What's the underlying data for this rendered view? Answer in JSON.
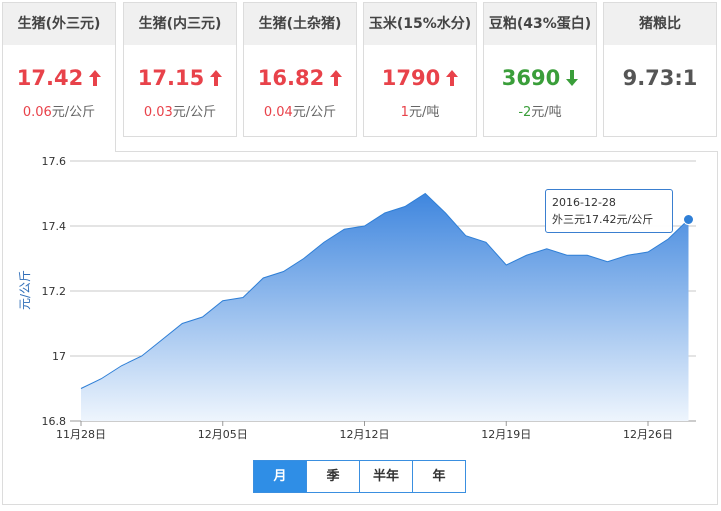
{
  "cards": [
    {
      "title": "生猪(外三元)",
      "price": "17.42",
      "direction": "up",
      "change_value": "0.06",
      "unit": "元/公斤",
      "active": true
    },
    {
      "title": "生猪(内三元)",
      "price": "17.15",
      "direction": "up",
      "change_value": "0.03",
      "unit": "元/公斤",
      "active": false
    },
    {
      "title": "生猪(土杂猪)",
      "price": "16.82",
      "direction": "up",
      "change_value": "0.04",
      "unit": "元/公斤",
      "active": false
    },
    {
      "title": "玉米(15%水分)",
      "price": "1790",
      "direction": "up",
      "change_value": "1",
      "unit": "元/吨",
      "active": false
    },
    {
      "title": "豆粕(43%蛋白)",
      "price": "3690",
      "direction": "down",
      "change_value": "-2",
      "unit": "元/吨",
      "active": false
    },
    {
      "title": "猪粮比",
      "price": "9.73:1",
      "direction": "none",
      "change_value": "",
      "unit": "",
      "active": false
    }
  ],
  "range_buttons": [
    {
      "label": "月",
      "active": true
    },
    {
      "label": "季",
      "active": false
    },
    {
      "label": "半年",
      "active": false
    },
    {
      "label": "年",
      "active": false
    }
  ],
  "tooltip": {
    "date": "2016-12-28",
    "text": "外三元17.42元/公斤"
  },
  "colors": {
    "up": "#e8424a",
    "down": "#3a9e3a",
    "accent": "#2f8ee6",
    "area_top": "#3f86de",
    "area_bottom": "#eef5fd"
  },
  "chart_data": {
    "type": "area",
    "ylabel": "元/公斤",
    "xlabel": "",
    "ylim": [
      16.8,
      17.6
    ],
    "yticks": [
      16.8,
      17,
      17.2,
      17.4,
      17.6
    ],
    "ytick_labels": [
      "16.8",
      "17",
      "17.2",
      "17.4",
      "17.6"
    ],
    "grid": true,
    "xticks": [
      {
        "date": "2016-11-28",
        "label": "11月28日"
      },
      {
        "date": "2016-12-05",
        "label": "12月05日"
      },
      {
        "date": "2016-12-12",
        "label": "12月12日"
      },
      {
        "date": "2016-12-19",
        "label": "12月19日"
      },
      {
        "date": "2016-12-26",
        "label": "12月26日"
      }
    ],
    "series": [
      {
        "x": [
          "2016-11-28",
          "2016-11-29",
          "2016-11-30",
          "2016-12-01",
          "2016-12-02",
          "2016-12-03",
          "2016-12-04",
          "2016-12-05",
          "2016-12-06",
          "2016-12-07",
          "2016-12-08",
          "2016-12-09",
          "2016-12-10",
          "2016-12-11",
          "2016-12-12",
          "2016-12-13",
          "2016-12-14",
          "2016-12-15",
          "2016-12-16",
          "2016-12-17",
          "2016-12-18",
          "2016-12-19",
          "2016-12-20",
          "2016-12-21",
          "2016-12-22",
          "2016-12-23",
          "2016-12-24",
          "2016-12-25",
          "2016-12-26",
          "2016-12-27",
          "2016-12-28"
        ],
        "values": [
          16.9,
          16.93,
          16.97,
          17.0,
          17.05,
          17.1,
          17.12,
          17.17,
          17.18,
          17.24,
          17.26,
          17.3,
          17.35,
          17.39,
          17.4,
          17.44,
          17.46,
          17.5,
          17.44,
          17.37,
          17.35,
          17.28,
          17.31,
          17.33,
          17.31,
          17.31,
          17.29,
          17.31,
          17.32,
          17.36,
          17.42
        ]
      }
    ]
  }
}
